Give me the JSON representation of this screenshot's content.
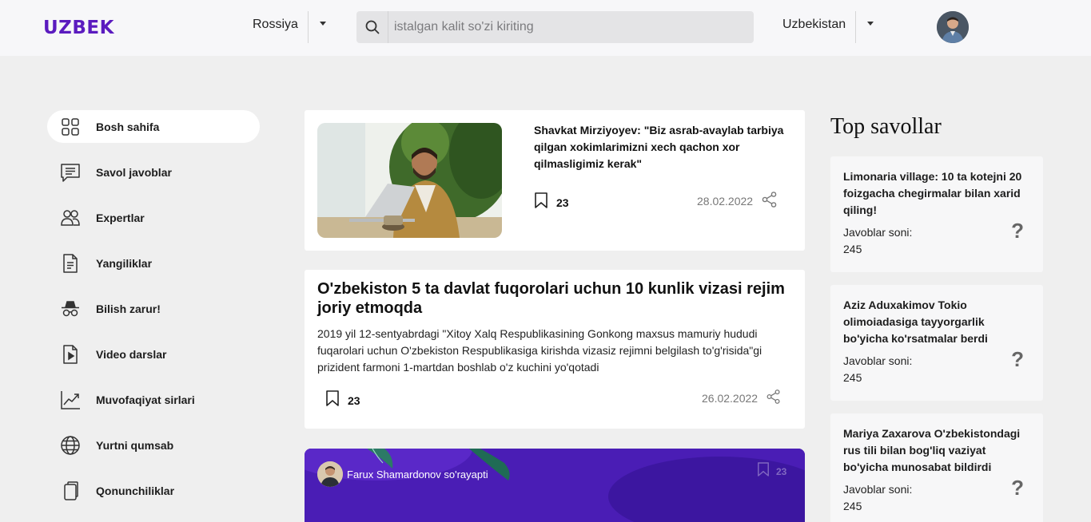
{
  "header": {
    "logo": "UZBEK",
    "country_left": "Rossiya",
    "search_placeholder": "istalgan kalit so'zi kiriting",
    "country_right": "Uzbekistan"
  },
  "sidebar": {
    "items": [
      {
        "label": "Bosh sahifa",
        "icon": "grid-icon",
        "active": true
      },
      {
        "label": "Savol javoblar",
        "icon": "chat-icon"
      },
      {
        "label": "Expertlar",
        "icon": "users-icon"
      },
      {
        "label": "Yangiliklar",
        "icon": "document-icon"
      },
      {
        "label": "Bilish zarur!",
        "icon": "spy-icon"
      },
      {
        "label": "Video darslar",
        "icon": "video-file-icon"
      },
      {
        "label": "Muvofaqiyat sirlari",
        "icon": "trend-chart-icon"
      },
      {
        "label": "Yurtni qumsab",
        "icon": "globe-icon"
      },
      {
        "label": "Qonunchiliklar",
        "icon": "copy-icon"
      }
    ]
  },
  "feed": {
    "post1": {
      "title": "Shavkat Mirziyoyev: \"Biz asrab-avaylab tarbiya qilgan xokimlarimizni xech qachon xor qilmasligimiz kerak\"",
      "saves": "23",
      "date": "28.02.2022"
    },
    "post2": {
      "title": "O'zbekiston 5 ta davlat fuqorolari uchun 10 kunlik vizasi rejim joriy etmoqda",
      "text": "2019 yil 12-sentyabrdagi \"Xitoy Xalq Respublikasining Gonkong maxsus mamuriy hududi fuqarolari uchun O'zbekiston Respublikasiga kirishda vizasiz rejimni belgilash to'g'risida\"gi prizident farmoni 1-martdan boshlab o'z kuchini yo'qotadi",
      "saves": "23",
      "date": "26.02.2022"
    },
    "post3": {
      "author": "Farux Shamardonov so'rayapti",
      "saves": "23"
    }
  },
  "top_questions": {
    "heading": "Top savollar",
    "answers_label": "Javoblar soni:",
    "items": [
      {
        "title": "Limonaria village: 10 ta kotejni 20 foizgacha chegirmalar bilan xarid qiling!",
        "count": "245"
      },
      {
        "title": "Aziz Aduxakimov Tokio olimoiadasiga tayyorgarlik bo'yicha ko'rsatmalar berdi",
        "count": "245"
      },
      {
        "title": "Mariya Zaxarova O'zbekistondagi rus tili bilan bog'liq vaziyat bo'yicha munosabat bildirdi",
        "count": "245"
      }
    ]
  },
  "colors": {
    "brand": "#5b1bbf",
    "background": "#efefef",
    "card": "#ffffff"
  }
}
